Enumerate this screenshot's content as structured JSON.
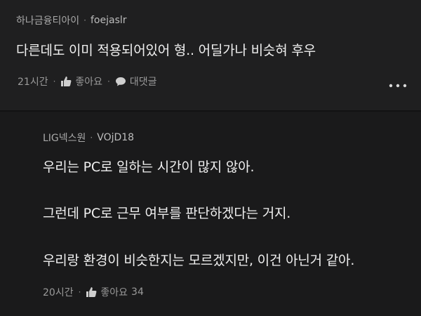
{
  "comment": {
    "author_name": "하나금융티아이",
    "author_sep": "·",
    "author_id": "foejaslr",
    "text": "다른데도 이미 적용되어있어 형.. 어딜가나 비슷혀 후우",
    "time": "21시간",
    "meta_sep": "·",
    "like_label": "좋아요",
    "reply_label": "대댓글",
    "more_icon": "more-horizontal-icon"
  },
  "reply": {
    "author_name": "LIG넥스원",
    "author_sep": "·",
    "author_id": "VOjD18",
    "lines": [
      "우리는 PC로 일하는 시간이 많지 않아.",
      "그런데 PC로 근무 여부를 판단하겠다는 거지.",
      "우리랑 환경이 비슷한지는 모르겠지만, 이건 아닌거 같아."
    ],
    "time": "20시간",
    "meta_sep": "·",
    "like_label": "좋아요",
    "like_count": "34"
  },
  "colors": {
    "background": "#1a1a1b",
    "comment_background": "#1f1f20",
    "text": "#f0f0f0",
    "muted": "#9a9a9a"
  }
}
